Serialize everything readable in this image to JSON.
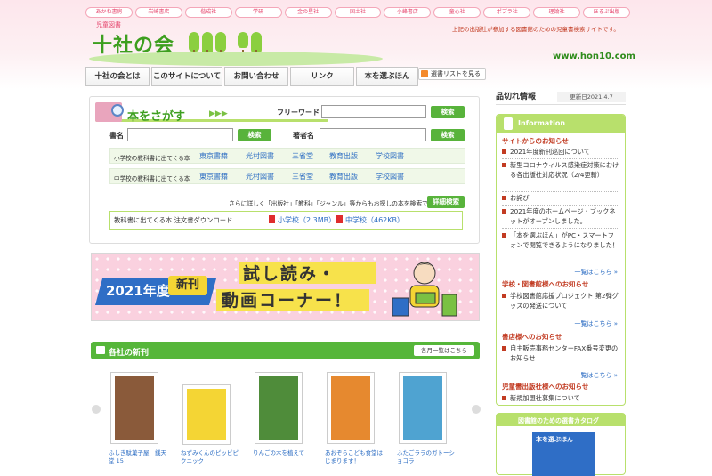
{
  "publishers": [
    "あかね書房",
    "岩崎書店",
    "偕成社",
    "学研",
    "金の星社",
    "国土社",
    "小峰書店",
    "童心社",
    "ポプラ社",
    "理論社",
    "ほるぷ出版"
  ],
  "site": {
    "small_title": "児童図書",
    "logo": "十社の会",
    "tagline": "上記の出版社が参加する図書館のための児童書検索サイトです。",
    "url": "www.hon10.com"
  },
  "nav": [
    "十社の会とは",
    "このサイトについて",
    "お問い合わせ",
    "リンク",
    "本を選ぶほん"
  ],
  "rss_label": "選書リストを見る",
  "search": {
    "title": "本をさがす",
    "free_word_label": "フリーワード",
    "free_word_value": "",
    "search_btn": "検索",
    "book_label": "書名",
    "book_value": "",
    "author_label": "著者名",
    "author_value": "",
    "row1_label": "小学校の教科書に出てくる本",
    "row1_links": [
      "東京書籍",
      "光村図書",
      "三省堂",
      "教育出版",
      "学校図書"
    ],
    "row2_label": "中学校の教科書に出てくる本",
    "row2_links": [
      "東京書籍",
      "光村図書",
      "三省堂",
      "教育出版",
      "学校図書"
    ],
    "note": "さらに詳しく「出版社」「教科」「ジャンル」等からもお探しの本を検索できます。",
    "detail_btn": "詳細検索",
    "download_label": "教科書に出てくる本 注文書ダウンロード",
    "download_links": [
      "小学校（2.3MB）",
      "中学校（462KB）"
    ]
  },
  "banner": {
    "year": "2021年度",
    "new": "新刊",
    "line1": "試し読み・",
    "line2": "動画コーナー！"
  },
  "new_books": {
    "title": "各社の新刊",
    "list_btn": "各月一覧はこちら",
    "items": [
      {
        "title": "ふしぎ駄菓子屋　銭天堂 15",
        "color": "#8a5a3a"
      },
      {
        "title": "ねずみくんのピッピピクニック",
        "color": "#f4d534"
      },
      {
        "title": "りんごの木を植えて",
        "color": "#4f8c3a"
      },
      {
        "title": "あおぞらこども食堂はじまります！",
        "color": "#e6892f"
      },
      {
        "title": "ふたごララのガトーショコラ",
        "color": "#4fa3d1"
      }
    ]
  },
  "sidebar": {
    "stock_title": "品切れ情報",
    "stock_date": "更新日2021.4.7",
    "info_title": "Information",
    "sections": [
      {
        "heading": "サイトからのお知らせ",
        "items": [
          "2021年度新刊巡回について",
          "新型コロナウィルス感染症対策における各出版社対応状況（2/4更新）",
          "お詫び",
          "2021年度のホームページ・ブックネットがオープンしました。",
          "「本を選ぶほん」がPC・スマートフォンで閲覧できるようになりました！"
        ],
        "more": "一覧はこちら »"
      },
      {
        "heading": "学校・図書館様へのお知らせ",
        "items": [
          "学校図書館応援プロジェクト 第2弾グッズの発送について"
        ],
        "more": "一覧はこちら »"
      },
      {
        "heading": "書店様へのお知らせ",
        "items": [
          "自主販売事務センターFAX番号変更のお知らせ"
        ],
        "more": "一覧はこちら »"
      },
      {
        "heading": "児童書出版社様へのお知らせ",
        "items": [
          "新規加盟社募集について"
        ]
      }
    ],
    "catalog_title": "図書館のための選書カタログ",
    "catalog_cover": "本を選ぶほん"
  }
}
